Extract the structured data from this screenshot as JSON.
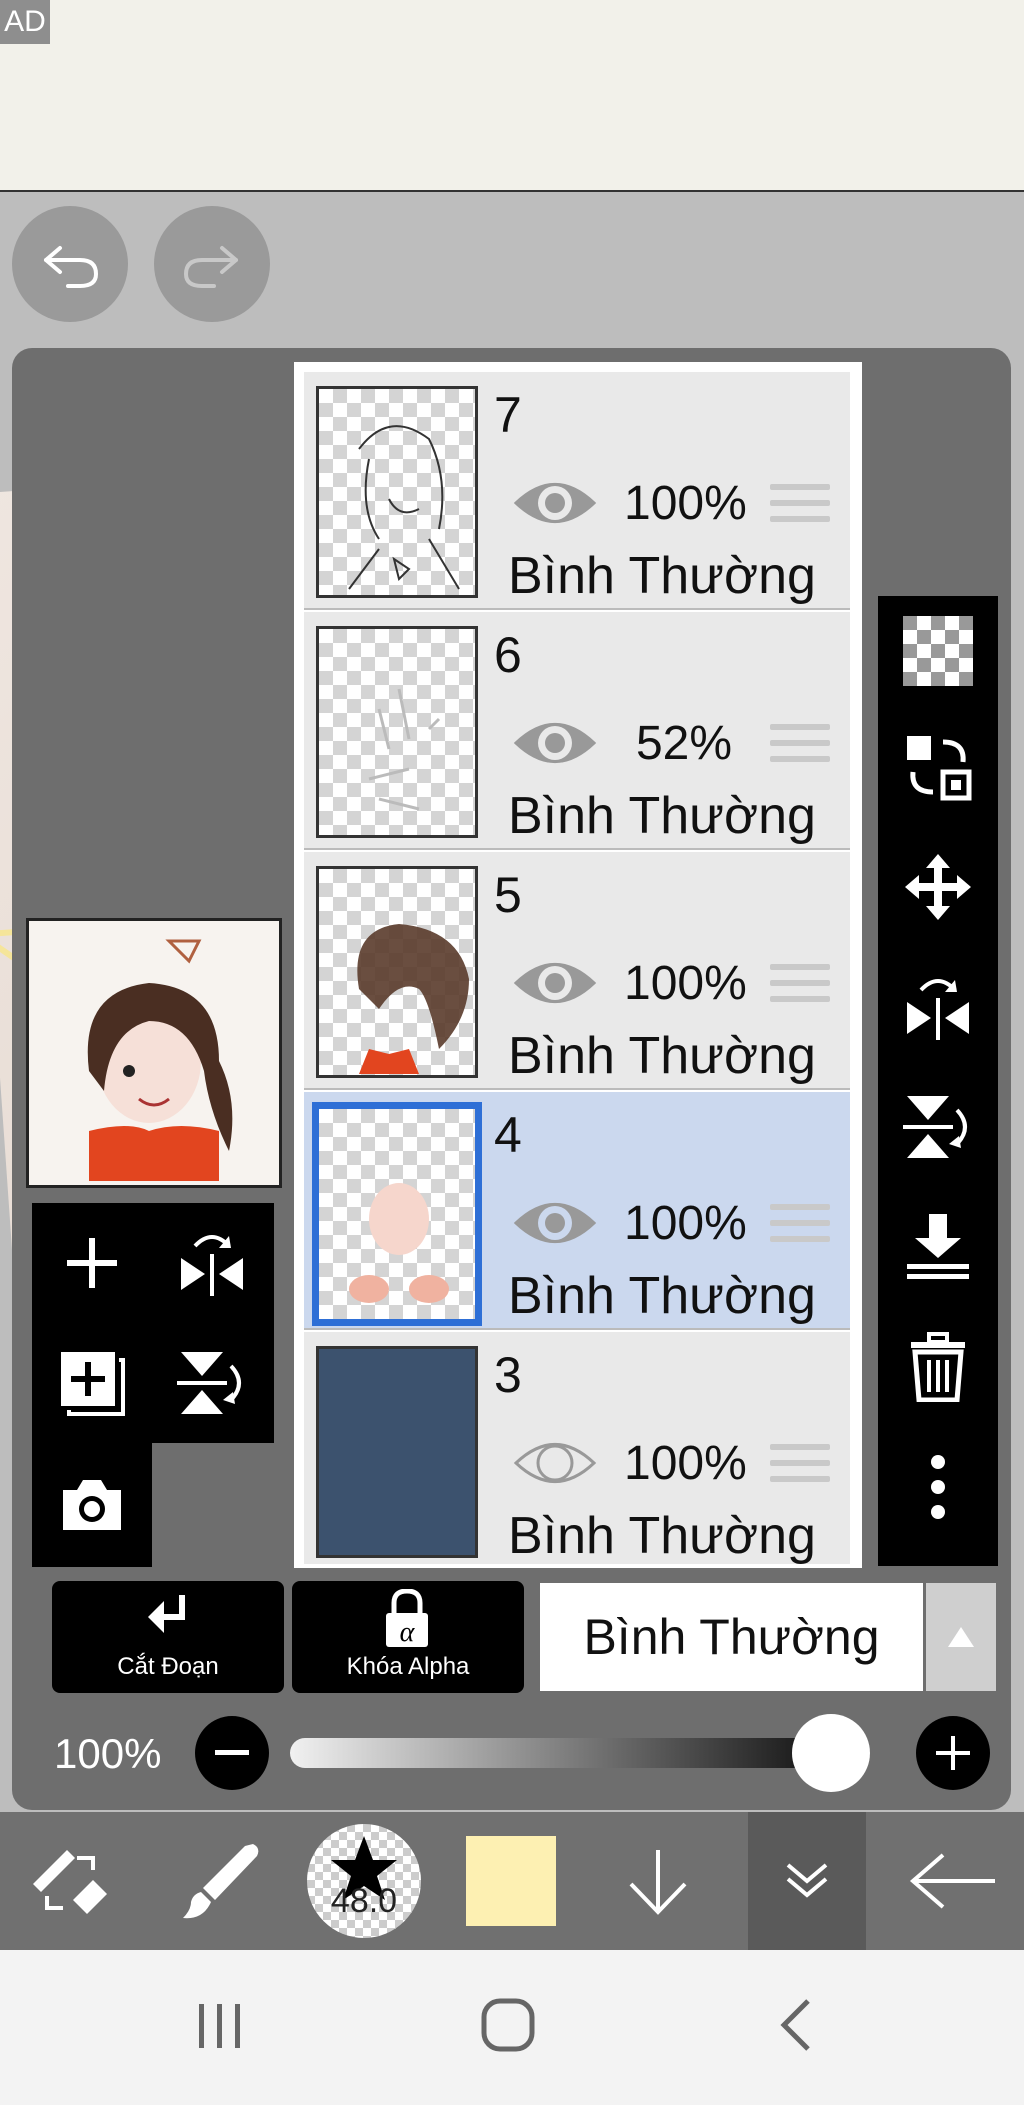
{
  "ad": {
    "label": "AD"
  },
  "layers": [
    {
      "number": "7",
      "opacity": "100%",
      "blend": "Bình Thường",
      "visible": true,
      "selected": false
    },
    {
      "number": "6",
      "opacity": "52%",
      "blend": "Bình Thường",
      "visible": true,
      "selected": false
    },
    {
      "number": "5",
      "opacity": "100%",
      "blend": "Bình Thường",
      "visible": true,
      "selected": false
    },
    {
      "number": "4",
      "opacity": "100%",
      "blend": "Bình Thường",
      "visible": true,
      "selected": true
    },
    {
      "number": "3",
      "opacity": "100%",
      "blend": "Bình Thường",
      "visible": false,
      "selected": false
    }
  ],
  "controls": {
    "clip_label": "Cắt Đoạn",
    "alpha_lock_label": "Khóa Alpha",
    "blend_mode": "Bình Thường",
    "layer_opacity_label": "100%",
    "layer_opacity_value": 1.0
  },
  "bottom_toolbar": {
    "brush_size": "48.0",
    "color": "#fdf0b2"
  },
  "colors": {
    "selection": "#2e6fd6",
    "selected_row": "#cbd8ee"
  },
  "icons": {
    "undo": "undo-icon",
    "redo": "redo-icon",
    "visibility": "eye-icon",
    "reorder": "drag-handle-icon",
    "transparent": "transparency-icon",
    "copy": "copy-layer-icon",
    "move": "move-icon",
    "flip_h": "flip-horizontal-icon",
    "flip_v": "flip-vertical-icon",
    "merge_down": "merge-down-icon",
    "delete": "trash-icon",
    "more": "more-vertical-icon",
    "add": "add-layer-icon",
    "add_with_copy": "add-copy-layer-icon",
    "camera": "camera-icon"
  }
}
